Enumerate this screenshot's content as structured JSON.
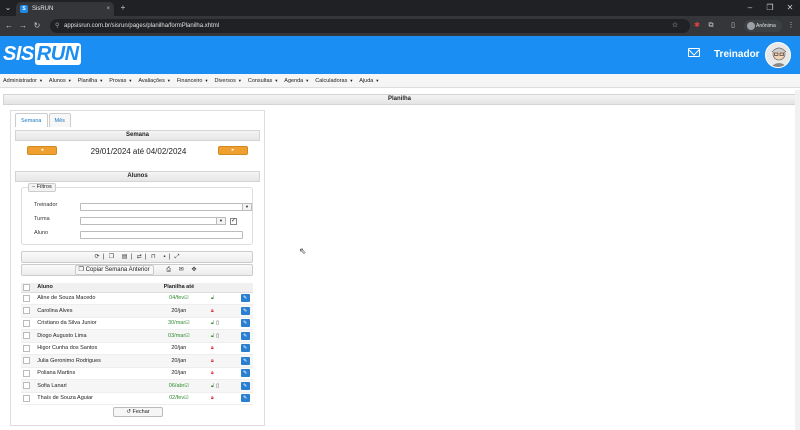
{
  "browser": {
    "tab_title": "SisRUN",
    "url": "appsisrun.com.br/sisrun/pages/planilha/formPlanilha.xhtml",
    "profile_label": "Anônima",
    "tab_favicon_letter": "S",
    "new_tab_label": "+",
    "close_tab_label": "×"
  },
  "header": {
    "logo_part1": "SIS",
    "logo_part2": "RUN",
    "user_role": "Treinador"
  },
  "menu": [
    {
      "label": "Administrador"
    },
    {
      "label": "Alunos"
    },
    {
      "label": "Planilha"
    },
    {
      "label": "Provas"
    },
    {
      "label": "Avaliações"
    },
    {
      "label": "Financeiro"
    },
    {
      "label": "Diversos"
    },
    {
      "label": "Consultas"
    },
    {
      "label": "Agenda"
    },
    {
      "label": "Calculadoras"
    },
    {
      "label": "Ajuda"
    }
  ],
  "page_title": "Planilha",
  "tabs": [
    {
      "label": "Semana",
      "active": true
    },
    {
      "label": "Mês",
      "active": false
    }
  ],
  "week": {
    "header": "Semana",
    "range": "29/01/2024 até 04/02/2024"
  },
  "students_section": {
    "header": "Alunos",
    "filters_label": "Filtros",
    "trainer_label": "Treinador",
    "class_label": "Turma",
    "student_label": "Aluno",
    "copy_week_label": "Copiar Semana Anterior"
  },
  "table": {
    "columns": [
      "Aluno",
      "Planilha até"
    ],
    "rows": [
      {
        "name": "Aline de Souza Macedo",
        "until": "04/fev",
        "status": "green",
        "checked": true,
        "lock": "open",
        "phone": false
      },
      {
        "name": "Carolina Alves",
        "until": "20/jan",
        "status": "dark",
        "checked": false,
        "lock": "closed",
        "phone": false
      },
      {
        "name": "Cristiano da Silva Junior",
        "until": "30/mar",
        "status": "green",
        "checked": true,
        "lock": "open",
        "phone": true
      },
      {
        "name": "Diogo Augusto Lima",
        "until": "03/mar",
        "status": "green",
        "checked": true,
        "lock": "open",
        "phone": true
      },
      {
        "name": "Higor Cunha dos Santos",
        "until": "20/jan",
        "status": "dark",
        "checked": false,
        "lock": "closed",
        "phone": false
      },
      {
        "name": "Julia Geronimo Rodrigues",
        "until": "20/jan",
        "status": "dark",
        "checked": false,
        "lock": "closed",
        "phone": false
      },
      {
        "name": "Poliana Martins",
        "until": "20/jan",
        "status": "dark",
        "checked": false,
        "lock": "closed",
        "phone": false
      },
      {
        "name": "Sofia Lanari",
        "until": "06/abr",
        "status": "green",
        "checked": true,
        "lock": "open",
        "phone": true
      },
      {
        "name": "Thaís de Souza Aguiar",
        "until": "02/fev",
        "status": "green",
        "checked": true,
        "lock": "closed",
        "phone": false
      }
    ]
  },
  "close_button": "Fechar",
  "colors": {
    "brand": "#1a8ef2",
    "accent_orange": "#f0a030",
    "ok_green": "#2e8b2e",
    "lock_red": "#e02020"
  }
}
